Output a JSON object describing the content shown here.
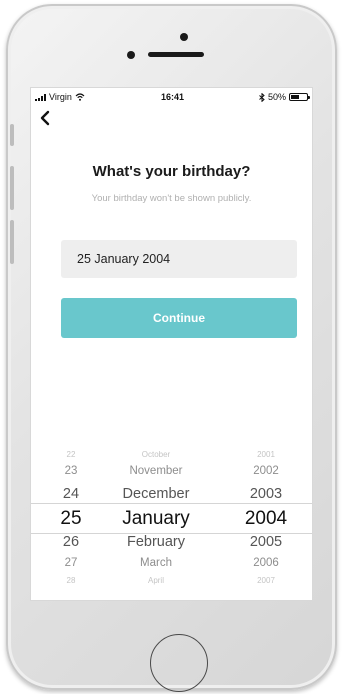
{
  "status_bar": {
    "carrier": "Virgin",
    "time": "16:41",
    "battery_text": "50%",
    "battery_level": 0.5
  },
  "header": {
    "title": "What's your birthday?",
    "subtitle": "Your birthday won't be shown publicly."
  },
  "date_field": {
    "value": "25 January 2004"
  },
  "continue_button": {
    "label": "Continue"
  },
  "picker": {
    "rows": [
      {
        "day": "22",
        "month": "October",
        "year": "2001"
      },
      {
        "day": "23",
        "month": "November",
        "year": "2002"
      },
      {
        "day": "24",
        "month": "December",
        "year": "2003"
      },
      {
        "day": "25",
        "month": "January",
        "year": "2004"
      },
      {
        "day": "26",
        "month": "February",
        "year": "2005"
      },
      {
        "day": "27",
        "month": "March",
        "year": "2006"
      },
      {
        "day": "28",
        "month": "April",
        "year": "2007"
      }
    ],
    "selected_index": 3
  }
}
